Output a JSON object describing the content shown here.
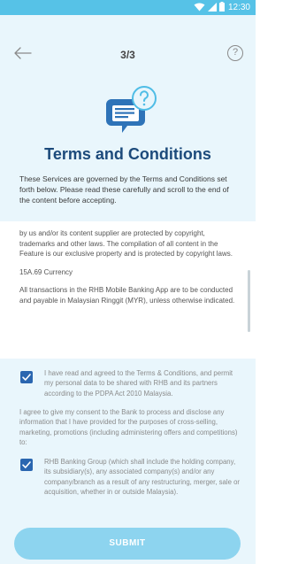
{
  "status_bar": {
    "time": "12:30",
    "icons": [
      "wifi-icon",
      "cellular-signal-icon",
      "battery-icon"
    ]
  },
  "nav": {
    "step": "3/3",
    "back_icon": "arrow-left-icon",
    "help_label": "?"
  },
  "header": {
    "illustration_icon": "document-question-icon",
    "title": "Terms and Conditions",
    "intro": "These Services are governed by the Terms and Conditions set forth below. Please read these carefully and scroll to the end of the content before accepting."
  },
  "terms": {
    "paragraphs": [
      "by us and/or its content supplier are protected by copyright, trademarks and other laws. The compilation of all content in the Feature is our exclusive property and is protected by copyright laws.",
      "15A.69 Currency",
      "All transactions in the RHB Mobile Banking App are to be conducted and payable in Malaysian Ringgit (MYR), unless otherwise indicated."
    ]
  },
  "consents": {
    "agree_terms": {
      "checked": true,
      "text": "I have read and agreed to the Terms & Conditions, and permit my personal data to be shared with RHB and its partners according to the PDPA Act 2010 Malaysia."
    },
    "marketing_intro": "I agree to give my consent to the Bank to process and disclose any information that I have provided for the purposes of cross-selling, marketing, promotions (including administering offers and competitions) to:",
    "rhb_group": {
      "checked": true,
      "text": "RHB Banking Group (which shall include the holding company, its subsidiary(s), any associated company(s) and/or any company/branch as a result of any restructuring, merger, sale or acquisition, whether in or outside Malaysia)."
    }
  },
  "actions": {
    "submit_label": "SUBMIT"
  },
  "colors": {
    "status_bar": "#56c2e7",
    "background": "#e9f6fc",
    "title": "#1c4a7b",
    "checkbox": "#2a66b0",
    "submit": "#8dd4ef"
  }
}
